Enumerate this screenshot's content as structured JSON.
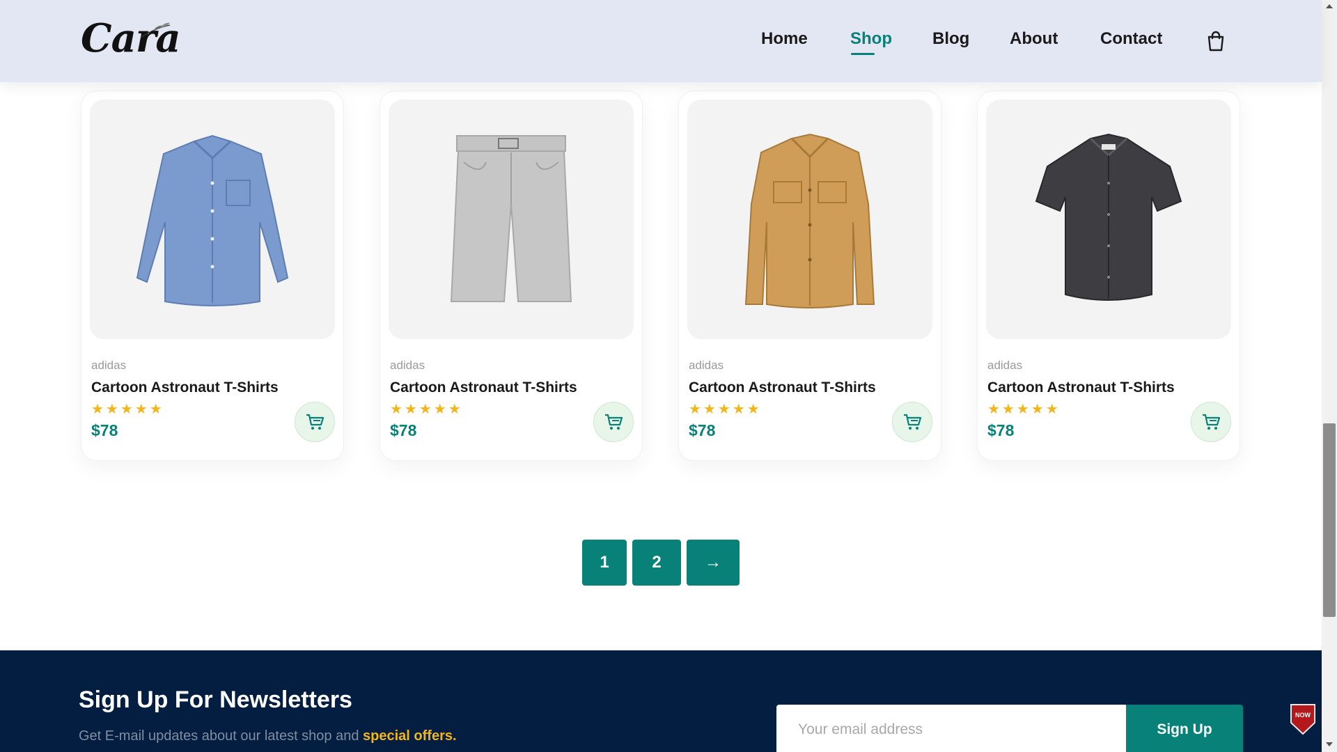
{
  "header": {
    "logo_text": "Cara",
    "nav": [
      "Home",
      "Shop",
      "Blog",
      "About",
      "Contact"
    ],
    "active_nav": "Shop",
    "accent_color": "#088178"
  },
  "products": [
    {
      "brand": "adidas",
      "name": "Cartoon Astronaut T-Shirts",
      "rating": 5,
      "stars": "★★★★★",
      "price": "$78",
      "image": "blue-long-sleeve-shirt"
    },
    {
      "brand": "adidas",
      "name": "Cartoon Astronaut T-Shirts",
      "rating": 5,
      "stars": "★★★★★",
      "price": "$78",
      "image": "grey-shorts"
    },
    {
      "brand": "adidas",
      "name": "Cartoon Astronaut T-Shirts",
      "rating": 5,
      "stars": "★★★★★",
      "price": "$78",
      "image": "tan-long-sleeve-shirt"
    },
    {
      "brand": "adidas",
      "name": "Cartoon Astronaut T-Shirts",
      "rating": 5,
      "stars": "★★★★★",
      "price": "$78",
      "image": "charcoal-short-sleeve-shirt"
    }
  ],
  "pagination": {
    "pages": [
      "1",
      "2"
    ],
    "next": "→"
  },
  "newsletter": {
    "title": "Sign Up For Newsletters",
    "subtitle_prefix": "Get E-mail updates about our latest shop and ",
    "subtitle_highlight": "special offers.",
    "input_placeholder": "Your email address",
    "button_label": "Sign Up",
    "background_color": "#041e42",
    "highlight_color": "#f3b519"
  },
  "badge_text": "NOW"
}
